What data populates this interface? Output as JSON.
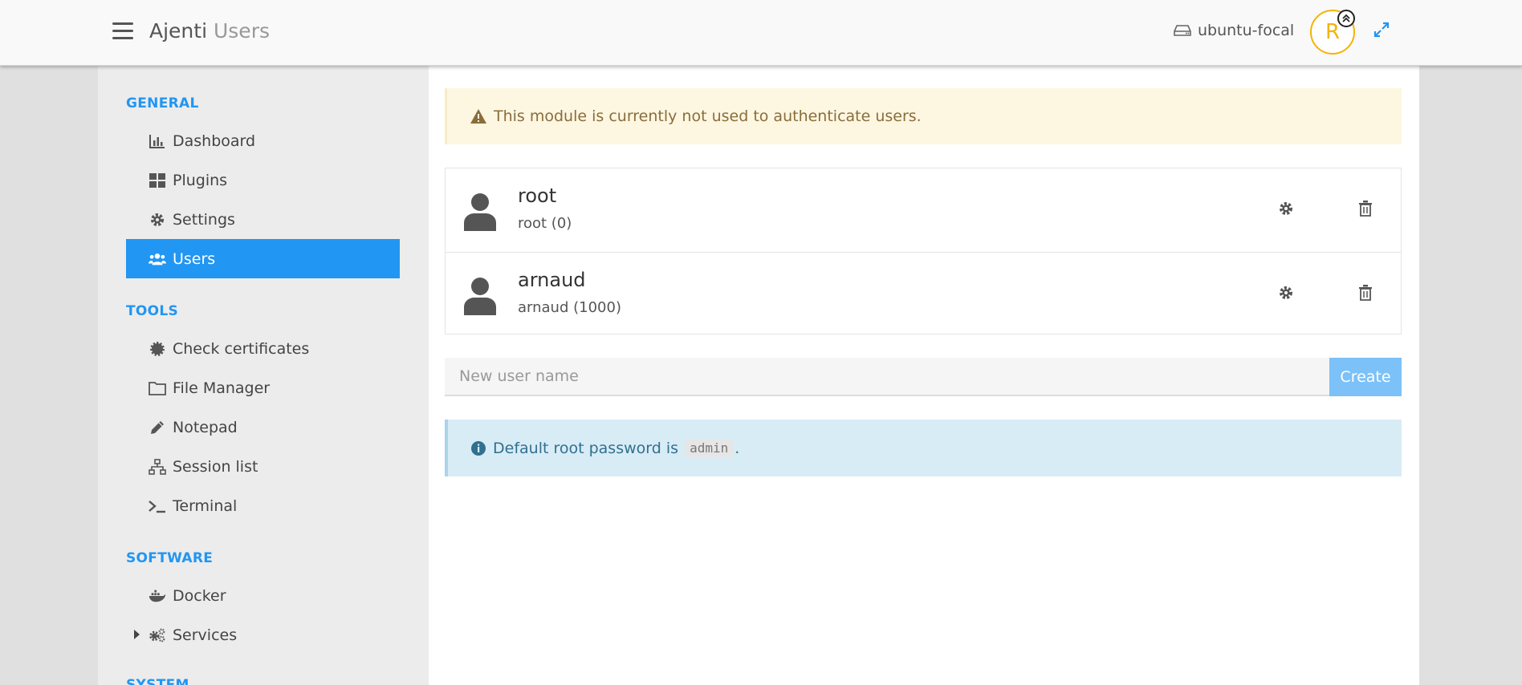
{
  "header": {
    "app_name": "Ajenti",
    "page_name": "Users",
    "hostname": "ubuntu-focal",
    "avatar_letter": "R"
  },
  "sidebar": {
    "sections": [
      {
        "title": "GENERAL",
        "items": [
          {
            "label": "Dashboard",
            "icon": "chart-icon"
          },
          {
            "label": "Plugins",
            "icon": "grid-icon"
          },
          {
            "label": "Settings",
            "icon": "gear-icon"
          },
          {
            "label": "Users",
            "icon": "users-icon",
            "active": true
          }
        ]
      },
      {
        "title": "TOOLS",
        "items": [
          {
            "label": "Check certificates",
            "icon": "certificate-icon"
          },
          {
            "label": "File Manager",
            "icon": "folder-icon"
          },
          {
            "label": "Notepad",
            "icon": "pencil-icon"
          },
          {
            "label": "Session list",
            "icon": "sitemap-icon"
          },
          {
            "label": "Terminal",
            "icon": "terminal-icon"
          }
        ]
      },
      {
        "title": "SOFTWARE",
        "items": [
          {
            "label": "Docker",
            "icon": "docker-icon"
          },
          {
            "label": "Services",
            "icon": "cogs-icon",
            "collapsed": true
          }
        ]
      },
      {
        "title": "SYSTEM",
        "items": []
      }
    ]
  },
  "main": {
    "warning_text": "This module is currently not used to authenticate users.",
    "users": [
      {
        "name": "root",
        "detail": "root (0)"
      },
      {
        "name": "arnaud",
        "detail": "arnaud (1000)"
      }
    ],
    "new_user_placeholder": "New user name",
    "create_label": "Create",
    "info_text_prefix": "Default root password is",
    "info_code": "admin",
    "info_text_suffix": "."
  },
  "colors": {
    "accent": "#2196f3",
    "warning_bg": "#fdf6e1",
    "info_bg": "#d8ecf6",
    "avatar": "#f4b400"
  }
}
